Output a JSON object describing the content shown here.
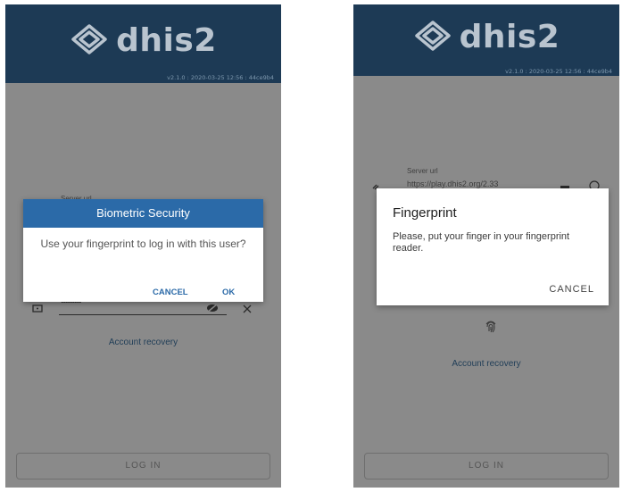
{
  "left_screen": {
    "header": {
      "logo_text": "dhis2",
      "version": "v2.1.0 : 2020-03-25 12:56 : 44ce9b4"
    },
    "server_label": "Server url",
    "password_value": "•••••••••",
    "account_recovery": "Account recovery",
    "login_button": "LOG IN",
    "dialog": {
      "title": "Biometric Security",
      "message": "Use your fingerprint to log in with this user?",
      "cancel": "CANCEL",
      "ok": "OK"
    }
  },
  "right_screen": {
    "header": {
      "logo_text": "dhis2",
      "version": "v2.1.0 : 2020-03-25 12:56 : 44ce9b4"
    },
    "server_label": "Server url",
    "server_value": "https://play.dhis2.org/2.33",
    "account_recovery": "Account recovery",
    "login_button": "LOG IN",
    "dialog": {
      "title": "Fingerprint",
      "message": "Please, put your finger in your fingerprint reader.",
      "cancel": "CANCEL"
    }
  },
  "colors": {
    "header_bg": "#1d3a55",
    "accent": "#2b6aa8",
    "overlay": "#8a8a8a"
  },
  "icons": [
    "dhis2-logo-icon",
    "link-icon",
    "lock-icon",
    "visibility-off-icon",
    "clear-icon",
    "qr-icon",
    "info-icon",
    "fingerprint-icon"
  ]
}
